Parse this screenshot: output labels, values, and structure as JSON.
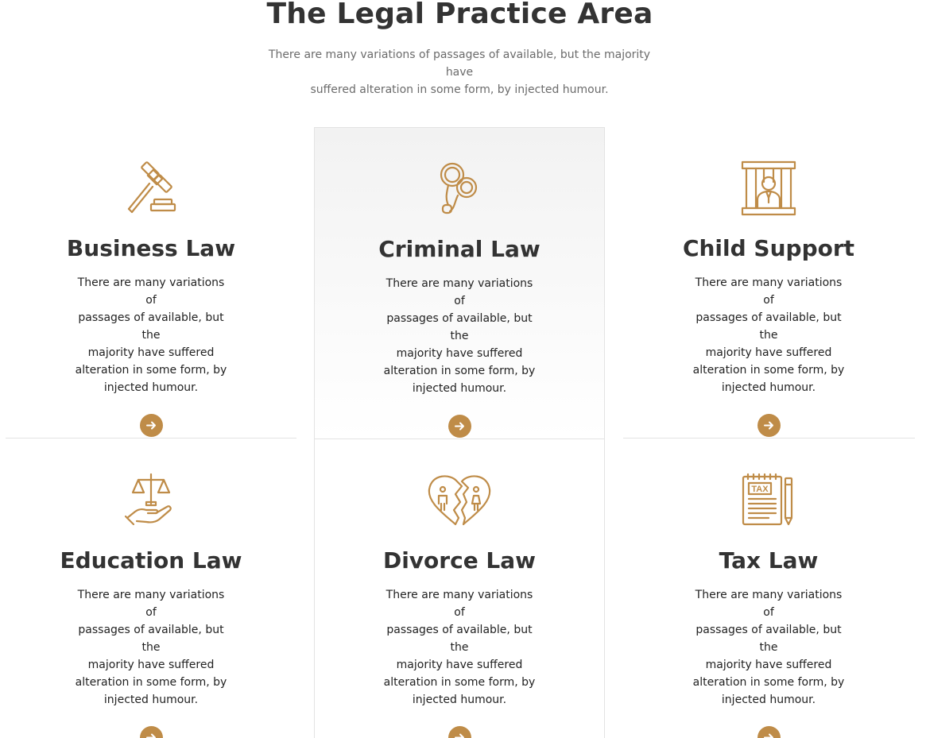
{
  "section": {
    "title": "The Legal Practice Area",
    "subtitle_line1": "There are many variations of passages of available, but the majority have",
    "subtitle_line2": "suffered alteration in some form, by injected humour."
  },
  "accent_color": "#bf8c48",
  "cards": [
    {
      "title": "Business Law",
      "icon": "gavel-icon",
      "lines": [
        "There are many variations of",
        "passages of available, but the",
        "majority have suffered",
        "alteration in some form, by",
        "injected humour."
      ]
    },
    {
      "title": "Criminal Law",
      "icon": "handcuffs-icon",
      "lines": [
        "There are many variations of",
        "passages of available, but the",
        "majority have suffered",
        "alteration in some form, by",
        "injected humour."
      ]
    },
    {
      "title": "Child Support",
      "icon": "prison-bars-icon",
      "lines": [
        "There are many variations of",
        "passages of available, but the",
        "majority have suffered",
        "alteration in some form, by",
        "injected humour."
      ]
    },
    {
      "title": "Education Law",
      "icon": "scales-in-hand-icon",
      "lines": [
        "There are many variations of",
        "passages of available, but the",
        "majority have suffered",
        "alteration in some form, by",
        "injected humour."
      ]
    },
    {
      "title": "Divorce Law",
      "icon": "broken-heart-icon",
      "lines": [
        "There are many variations of",
        "passages of available, but the",
        "majority have suffered",
        "alteration in some form, by",
        "injected humour."
      ]
    },
    {
      "title": "Tax Law",
      "icon": "tax-document-icon",
      "lines": [
        "There are many variations of",
        "passages of available, but the",
        "majority have suffered",
        "alteration in some form, by",
        "injected humour."
      ]
    }
  ],
  "tax_icon_label": "TAX"
}
